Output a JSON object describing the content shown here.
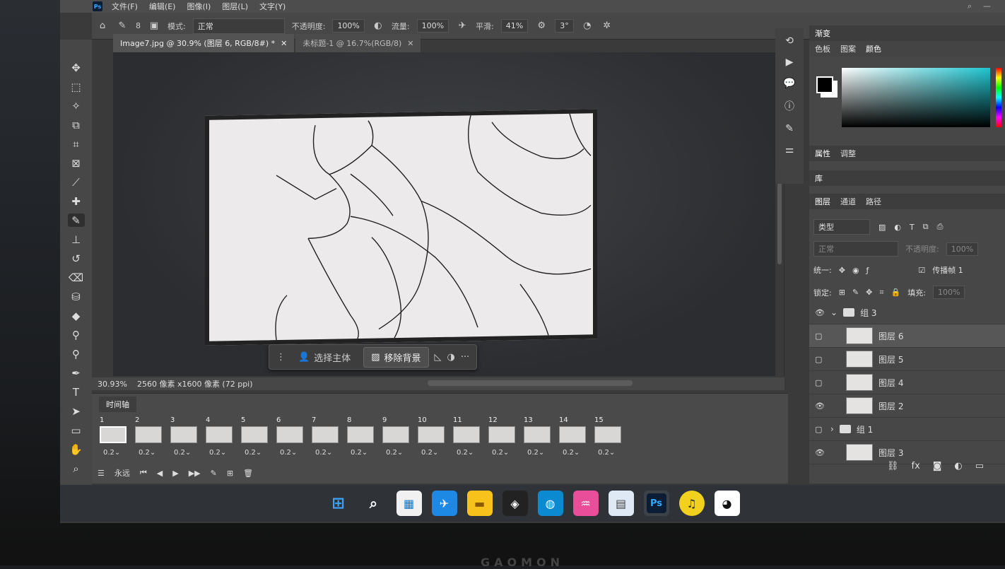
{
  "app": {
    "logo_text": "Ps",
    "menus": [
      "文件(F)",
      "编辑(E)",
      "图像(I)",
      "图层(L)",
      "文字(Y)"
    ]
  },
  "options_bar": {
    "brush_size": "8",
    "mode_label": "模式:",
    "mode_value": "正常",
    "opacity_label": "不透明度:",
    "opacity_value": "100%",
    "flow_label": "流量:",
    "flow_value": "100%",
    "smooth_label": "平滑:",
    "smooth_value": "41%",
    "angle_value": "3°"
  },
  "tabs": [
    {
      "label": "Image7.jpg @ 30.9% (图层 6, RGB/8#) *"
    },
    {
      "label": "未标题-1 @ 16.7%(RGB/8)"
    }
  ],
  "context_bar": {
    "select_subject": "选择主体",
    "remove_bg": "移除背景",
    "more": "···"
  },
  "status_bar": {
    "zoom": "30.93%",
    "doc_info": "2560 像素 x1600 像素 (72 ppi)"
  },
  "timeline": {
    "title": "时间轴",
    "loop": "永远",
    "frames": [
      {
        "num": "1",
        "dur": "0.2"
      },
      {
        "num": "2",
        "dur": "0.2"
      },
      {
        "num": "3",
        "dur": "0.2"
      },
      {
        "num": "4",
        "dur": "0.2"
      },
      {
        "num": "5",
        "dur": "0.2"
      },
      {
        "num": "6",
        "dur": "0.2"
      },
      {
        "num": "7",
        "dur": "0.2"
      },
      {
        "num": "8",
        "dur": "0.2"
      },
      {
        "num": "9",
        "dur": "0.2"
      },
      {
        "num": "10",
        "dur": "0.2"
      },
      {
        "num": "11",
        "dur": "0.2"
      },
      {
        "num": "12",
        "dur": "0.2"
      },
      {
        "num": "13",
        "dur": "0.2"
      },
      {
        "num": "14",
        "dur": "0.2"
      },
      {
        "num": "15",
        "dur": "0.2"
      }
    ]
  },
  "panels": {
    "gradient_tab": "渐变",
    "color_tabs": [
      "色板",
      "图案",
      "颜色"
    ],
    "props_tabs": [
      "属性",
      "调整"
    ],
    "library_tab": "库",
    "layers_tabs": [
      "图层",
      "通道",
      "路径"
    ],
    "filter_kind": "类型",
    "blend_mode": "正常",
    "opacity_label": "不透明度:",
    "opacity_value": "100%",
    "unify_label": "统一:",
    "propagate_label": "传播帧 1",
    "lock_label": "锁定:",
    "fill_label": "填充:",
    "fill_value": "100%",
    "layers": [
      {
        "name": "组 3",
        "type": "group",
        "visible": true,
        "expanded": true
      },
      {
        "name": "图层 6",
        "type": "layer",
        "visible": false,
        "active": true
      },
      {
        "name": "图层 5",
        "type": "layer",
        "visible": false
      },
      {
        "name": "图层 4",
        "type": "layer",
        "visible": false
      },
      {
        "name": "图层 2",
        "type": "layer",
        "visible": true
      },
      {
        "name": "组 1",
        "type": "group",
        "visible": false,
        "expanded": false
      },
      {
        "name": "图层 3",
        "type": "layer",
        "visible": true
      }
    ]
  },
  "taskbar": {
    "apps": [
      "start",
      "search",
      "store",
      "feishu",
      "files",
      "unity",
      "edge",
      "audio",
      "calculator",
      "photoshop",
      "music",
      "qq"
    ],
    "ps_label": "Ps"
  },
  "brand": "GAOMON",
  "colors": {
    "accent": "#31a8ff",
    "ui_bg": "#474747"
  }
}
